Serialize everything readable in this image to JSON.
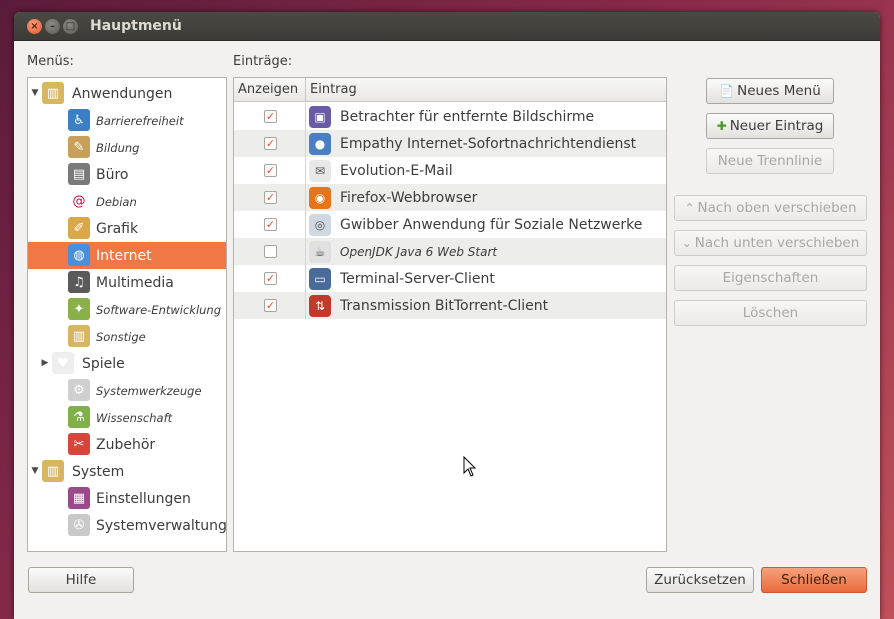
{
  "window": {
    "title": "Hauptmenü",
    "close_glyph": "×",
    "min_glyph": "–",
    "max_glyph": "□"
  },
  "menus_label": "Menüs:",
  "entries_label": "Einträge:",
  "menu_tree": [
    {
      "label": "Anwendungen",
      "icon": "applications-folder-icon",
      "style": "big",
      "expander": "▼",
      "selected": false
    },
    {
      "label": "Barrierefreiheit",
      "icon": "accessibility-icon",
      "style": "small",
      "selected": false
    },
    {
      "label": "Bildung",
      "icon": "education-icon",
      "style": "small",
      "selected": false
    },
    {
      "label": "Büro",
      "icon": "office-icon",
      "style": "big",
      "selected": false
    },
    {
      "label": "Debian",
      "icon": "debian-swirl-icon",
      "style": "small",
      "selected": false
    },
    {
      "label": "Grafik",
      "icon": "graphics-icon",
      "style": "big",
      "selected": false
    },
    {
      "label": "Internet",
      "icon": "globe-icon",
      "style": "big",
      "selected": true
    },
    {
      "label": "Multimedia",
      "icon": "multimedia-icon",
      "style": "big",
      "selected": false
    },
    {
      "label": "Software-Entwicklung",
      "icon": "development-icon",
      "style": "small",
      "selected": false
    },
    {
      "label": "Sonstige",
      "icon": "other-folder-icon",
      "style": "small",
      "selected": false
    },
    {
      "label": "Spiele",
      "icon": "playing-cards-icon",
      "style": "big",
      "expander": "▶",
      "selected": false
    },
    {
      "label": "Systemwerkzeuge",
      "icon": "system-tools-gear-icon",
      "style": "small",
      "selected": false
    },
    {
      "label": "Wissenschaft",
      "icon": "science-flasks-icon",
      "style": "small",
      "selected": false
    },
    {
      "label": "Zubehör",
      "icon": "accessories-knife-icon",
      "style": "big",
      "selected": false
    },
    {
      "label": "System",
      "icon": "system-folder-icon",
      "style": "big",
      "expander": "▼",
      "selected": false
    },
    {
      "label": "Einstellungen",
      "icon": "preferences-icon",
      "style": "big",
      "selected": false
    },
    {
      "label": "Systemverwaltung",
      "icon": "administration-icon",
      "style": "big",
      "selected": false
    }
  ],
  "entries_table": {
    "columns": [
      "Anzeigen",
      "Eintrag"
    ],
    "rows": [
      {
        "show": true,
        "label": "Betrachter für entfernte Bildschirme",
        "icon": "remote-desktop-icon",
        "italic": false
      },
      {
        "show": true,
        "label": "Empathy Internet-Sofortnachrichtendienst",
        "icon": "empathy-chat-icon",
        "italic": false
      },
      {
        "show": true,
        "label": "Evolution-E-Mail",
        "icon": "email-envelope-icon",
        "italic": false
      },
      {
        "show": true,
        "label": "Firefox-Webbrowser",
        "icon": "firefox-icon",
        "italic": false
      },
      {
        "show": true,
        "label": "Gwibber Anwendung für Soziale Netzwerke",
        "icon": "gwibber-icon",
        "italic": false
      },
      {
        "show": false,
        "label": "OpenJDK Java 6 Web Start",
        "icon": "java-icon",
        "italic": true
      },
      {
        "show": true,
        "label": "Terminal-Server-Client",
        "icon": "terminal-server-icon",
        "italic": false
      },
      {
        "show": true,
        "label": "Transmission BitTorrent-Client",
        "icon": "transmission-icon",
        "italic": false
      }
    ]
  },
  "check_glyph": "✓",
  "buttons": {
    "new_menu": "Neues Menü",
    "new_entry": "Neuer Eintrag",
    "new_separator": "Neue Trennlinie",
    "move_up": "Nach oben verschieben",
    "move_down": "Nach unten verschieben",
    "properties": "Eigenschaften",
    "delete": "Löschen",
    "help": "Hilfe",
    "revert": "Zurücksetzen",
    "close": "Schließen"
  },
  "button_glyphs": {
    "new_menu": "📄",
    "new_entry": "✚",
    "move_up": "⌃",
    "move_down": "⌄"
  },
  "colors": {
    "selection": "#f07746",
    "close_button": "#ea6b3d",
    "checkmark": "#e2542a"
  }
}
